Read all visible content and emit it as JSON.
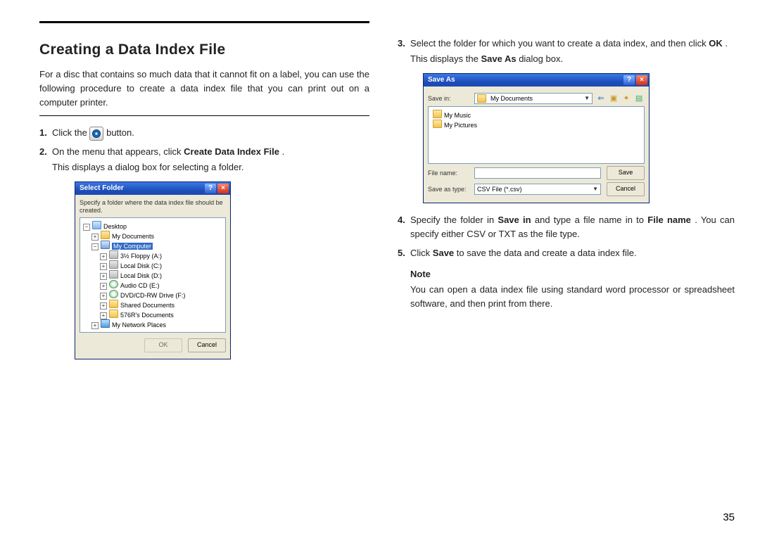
{
  "heading": "Creating a Data Index File",
  "intro": "For a disc that contains so much data that it cannot fit on a label, you can use the following procedure to create a data index file that you can print out on a computer printer.",
  "step1_pre": "Click the ",
  "step1_post": " button.",
  "step2_a": "On the menu that appears, click ",
  "step2_b": "Create Data Index File",
  "step2_c": ".",
  "step2_sub": "This displays a dialog box for selecting a folder.",
  "dialog1": {
    "title": "Select Folder",
    "hint": "Specify a folder where the data index file should be created.",
    "ok": "OK",
    "cancel": "Cancel",
    "tree": {
      "desktop": "Desktop",
      "mydocs": "My Documents",
      "mycomp": "My Computer",
      "floppy": "3½ Floppy (A:)",
      "c": "Local Disk (C:)",
      "d": "Local Disk (D:)",
      "e": "Audio CD (E:)",
      "f": "DVD/CD-RW Drive (F:)",
      "shared": "Shared Documents",
      "userdocs": "576R's Documents",
      "netplaces": "My Network Places"
    }
  },
  "step3_a": "Select the folder for which you want to create a data index, and then click ",
  "step3_b": "OK",
  "step3_c": ".",
  "step3_sub_a": "This displays the ",
  "step3_sub_b": "Save As",
  "step3_sub_c": " dialog box.",
  "dialog2": {
    "title": "Save As",
    "savein_label": "Save in:",
    "savein_value": "My Documents",
    "list": {
      "music": "My Music",
      "pics": "My Pictures"
    },
    "fname_label": "File name:",
    "type_label": "Save as type:",
    "type_value": "CSV File (*.csv)",
    "save": "Save",
    "cancel": "Cancel"
  },
  "step4_a": "Specify the folder in ",
  "step4_b": "Save in",
  "step4_c": " and type a file name in to ",
  "step4_d": "File name",
  "step4_e": ". You can specify either CSV or TXT as the file type.",
  "step5_a": "Click ",
  "step5_b": "Save",
  "step5_c": " to save the data and create a data index file.",
  "note_label": "Note",
  "note_text": "You can open a data index file using standard word processor or spreadsheet software, and then print from there.",
  "page_number": "35"
}
